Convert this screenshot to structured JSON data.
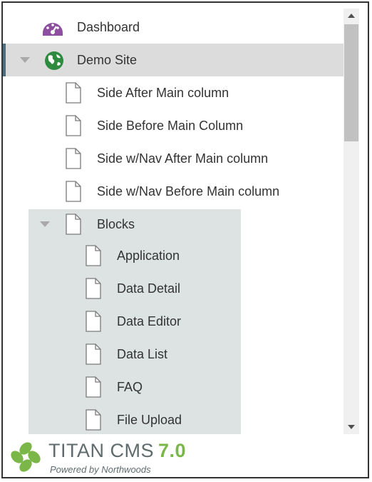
{
  "tree": {
    "dashboard": {
      "label": "Dashboard",
      "icon": "dashboard-gauge-icon",
      "icon_color": "#8e4fa0"
    },
    "site": {
      "label": "Demo Site",
      "icon": "globe-icon",
      "icon_color": "#2e8a3e",
      "expanded": true,
      "selected": true
    },
    "pages": [
      {
        "label": "Side After Main column",
        "icon": "page-icon"
      },
      {
        "label": "Side Before Main Column",
        "icon": "page-icon"
      },
      {
        "label": "Side w/Nav After Main column",
        "icon": "page-icon"
      },
      {
        "label": "Side w/Nav Before Main column",
        "icon": "page-icon"
      }
    ],
    "blocks": {
      "label": "Blocks",
      "icon": "page-icon",
      "expanded": true,
      "highlight_color": "#dce3e2",
      "children": [
        {
          "label": "Application",
          "icon": "page-icon"
        },
        {
          "label": "Data Detail",
          "icon": "page-icon"
        },
        {
          "label": "Data Editor",
          "icon": "page-icon"
        },
        {
          "label": "Data List",
          "icon": "page-icon"
        },
        {
          "label": "FAQ",
          "icon": "page-icon"
        },
        {
          "label": "File Upload",
          "icon": "page-icon"
        }
      ]
    }
  },
  "footer": {
    "brand": "TITAN CMS",
    "version": "7.0",
    "tagline": "Powered by Northwoods",
    "brand_color": "#5f6b6d",
    "version_color": "#7ab648",
    "logo_icon": "titan-logo-icon"
  }
}
